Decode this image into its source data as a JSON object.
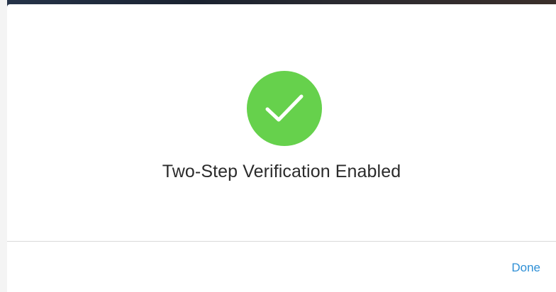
{
  "dialog": {
    "status_icon": "checkmark-circle-icon",
    "title": "Two-Step Verification Enabled",
    "done_label": "Done"
  },
  "colors": {
    "success": "#66d14c",
    "link": "#2e8fd6"
  }
}
